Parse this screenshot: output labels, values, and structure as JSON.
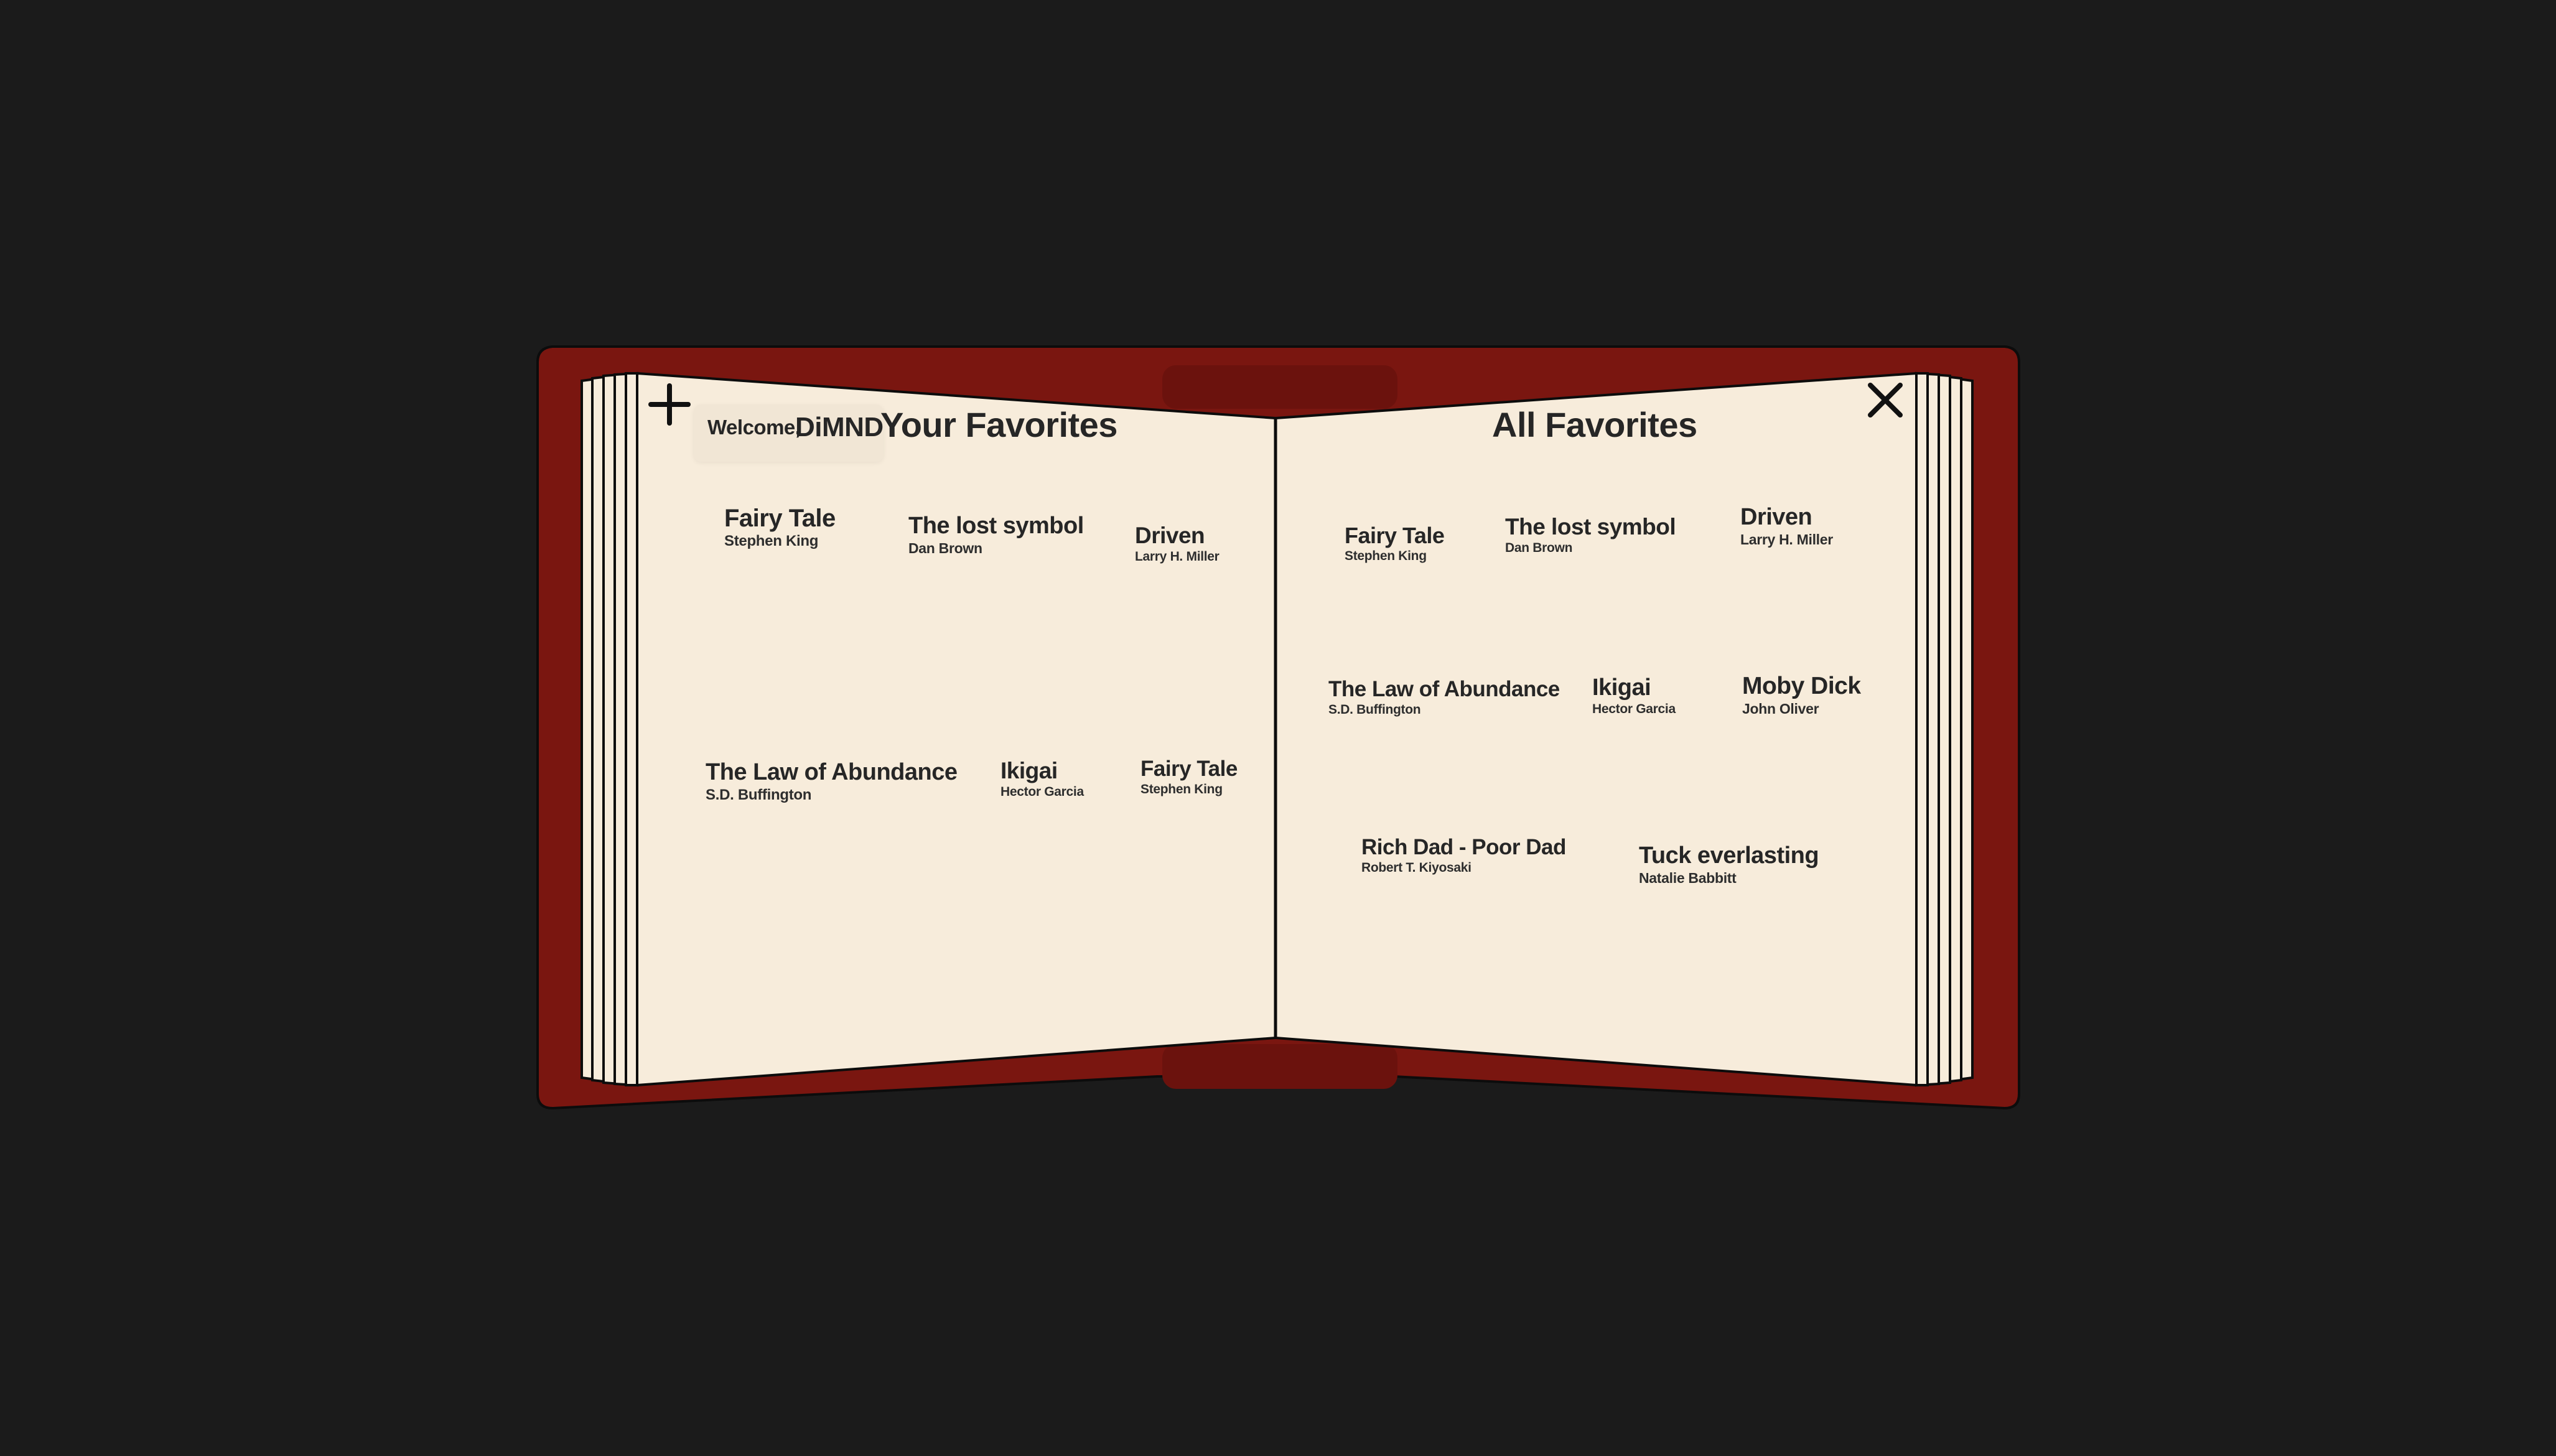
{
  "colors": {
    "background": "#1b1b1b",
    "cover": "#7a1610",
    "page": "#f7ecdb",
    "ink": "#262626"
  },
  "header": {
    "welcome_label": "Welcome,",
    "username": "DiMND",
    "left_title": "Your Favorites",
    "right_title": "All Favorites"
  },
  "icons": {
    "add": "plus-icon",
    "close": "close-icon"
  },
  "left_page": {
    "books": [
      {
        "title": "Fairy Tale",
        "author": "Stephen King"
      },
      {
        "title": "The lost symbol",
        "author": "Dan Brown"
      },
      {
        "title": "Driven",
        "author": "Larry H. Miller"
      },
      {
        "title": "The Law of Abundance",
        "author": "S.D. Buffington"
      },
      {
        "title": "Ikigai",
        "author": "Hector Garcia"
      },
      {
        "title": "Fairy Tale",
        "author": "Stephen King"
      }
    ]
  },
  "right_page": {
    "books": [
      {
        "title": "Fairy Tale",
        "author": "Stephen King"
      },
      {
        "title": "The lost symbol",
        "author": "Dan Brown"
      },
      {
        "title": "Driven",
        "author": "Larry H. Miller"
      },
      {
        "title": "The Law of Abundance",
        "author": "S.D. Buffington"
      },
      {
        "title": "Ikigai",
        "author": "Hector Garcia"
      },
      {
        "title": "Moby Dick",
        "author": "John Oliver"
      },
      {
        "title": "Rich Dad - Poor Dad",
        "author": "Robert T. Kiyosaki"
      },
      {
        "title": "Tuck everlasting",
        "author": "Natalie Babbitt"
      }
    ]
  }
}
